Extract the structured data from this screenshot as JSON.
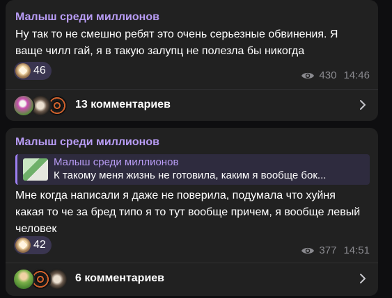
{
  "posts": [
    {
      "author": "Малыш среди миллионов",
      "text": "Ну так то не смешно ребят это очень серьезные обвинения. Я ваще чилл гай, я в такую залупц не полезла бы никогда",
      "reaction_count": "46",
      "views": "430",
      "time": "14:46",
      "comments_label": "13 комментариев"
    },
    {
      "author": "Малыш среди миллионов",
      "reply": {
        "author": "Малыш среди миллионов",
        "text": "К такому меня жизнь не готовила, каким я вообще бок..."
      },
      "text": "Мне когда написали я даже не поверила, подумала что хуйня какая то че за бред типо я то тут вообще причем, я вообще левый человек",
      "reaction_count": "42",
      "views": "377",
      "time": "14:51",
      "comments_label": "6 комментариев"
    }
  ],
  "colors": {
    "background": "#0e0e10",
    "card": "#212121",
    "author": "#b89cf5",
    "reaction_bg": "#3a3550",
    "meta": "#8a8a8f"
  },
  "icons": {
    "reaction": "heart-hands-emoji",
    "views": "eye-icon",
    "open": "chevron-right-icon"
  }
}
